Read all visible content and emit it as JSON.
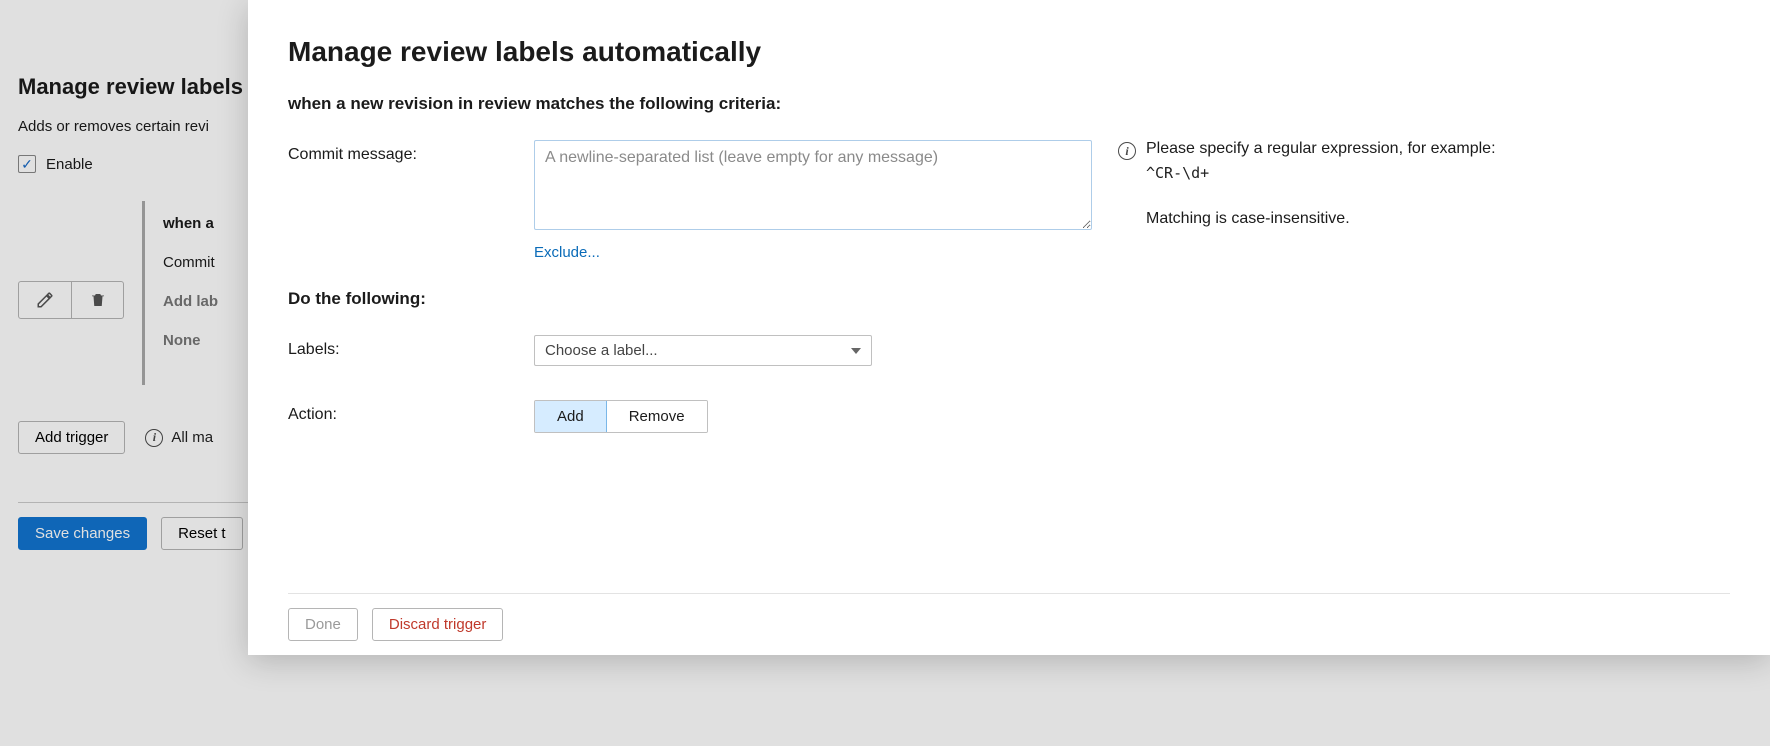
{
  "page": {
    "title": "Manage review labels",
    "description": "Adds or removes certain revi",
    "enable_label": "Enable",
    "trigger": {
      "heading": "when a",
      "commit_label": "Commit",
      "add_labels_label": "Add lab",
      "none_label": "None"
    },
    "add_trigger_label": "Add trigger",
    "info_text": "All ma",
    "save_label": "Save changes",
    "reset_label": "Reset t"
  },
  "modal": {
    "title": "Manage review labels automatically",
    "criteria_heading": "when a new revision in review matches the following criteria:",
    "commit_message_label": "Commit message:",
    "commit_message_placeholder": "A newline-separated list (leave empty for any message)",
    "exclude_link": "Exclude...",
    "hint": {
      "line1": "Please specify a regular expression, for example:",
      "example": "^CR-\\d+",
      "line2": "Matching is case-insensitive."
    },
    "do_heading": "Do the following:",
    "labels_label": "Labels:",
    "labels_placeholder": "Choose a label...",
    "action_label": "Action:",
    "action_add": "Add",
    "action_remove": "Remove",
    "done_label": "Done",
    "discard_label": "Discard trigger"
  }
}
